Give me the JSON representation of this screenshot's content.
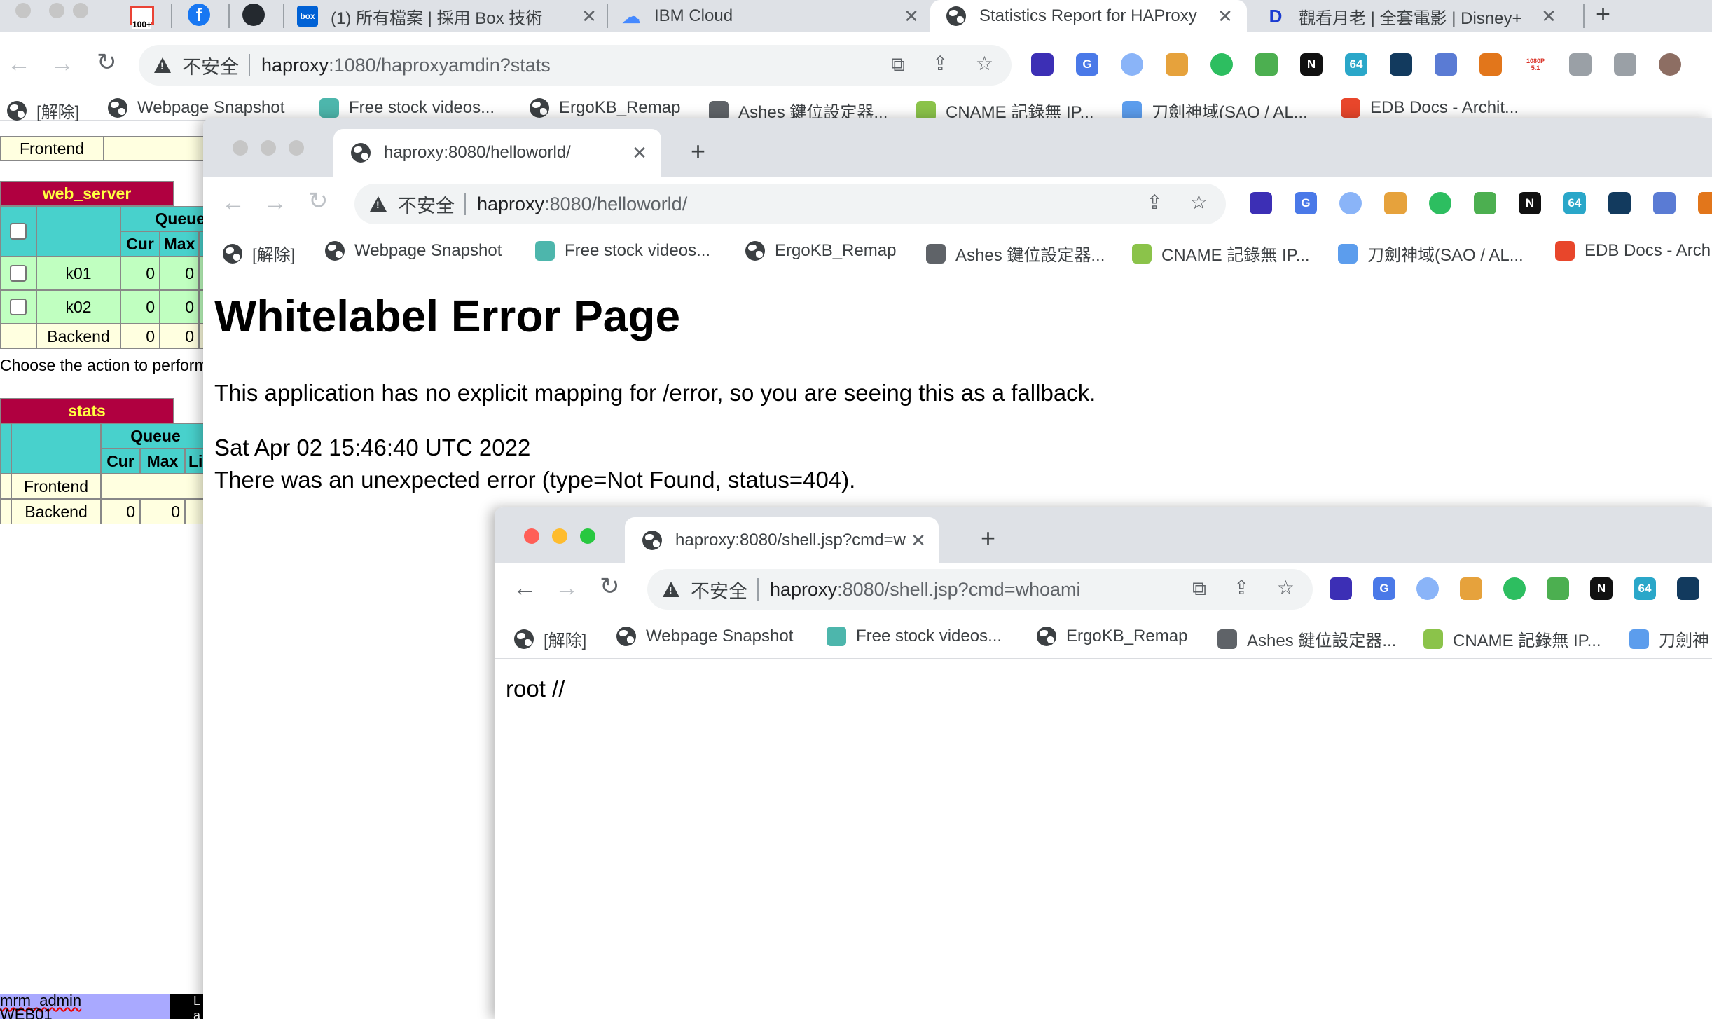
{
  "main_window": {
    "tabs": [
      {
        "favicon": "gmail-icon",
        "badge": "100+"
      },
      {
        "favicon": "facebook-icon"
      },
      {
        "favicon": "github-icon"
      },
      {
        "favicon": "box-icon",
        "title": "(1) 所有檔案 | 採用 Box 技術"
      },
      {
        "favicon": "cloud-icon",
        "title": "IBM Cloud"
      },
      {
        "favicon": "globe-icon",
        "title": "Statistics Report for HAProxy",
        "active": true
      },
      {
        "favicon": "disney-icon",
        "title": "觀看月老 | 全套電影 | Disney+"
      }
    ],
    "omnibox": {
      "insecure": "不安全",
      "host": "haproxy",
      "rest": ":1080/haproxyamdin?stats"
    },
    "extensions": [
      {
        "name": "layers-icon",
        "color": "#3c2fb5",
        "text": ""
      },
      {
        "name": "translate-icon",
        "color": "#4a79e8",
        "text": "G"
      },
      {
        "name": "ring-icon",
        "color": "#8ab4f8",
        "text": ""
      },
      {
        "name": "gallery-icon",
        "color": "#e6a23c",
        "text": ""
      },
      {
        "name": "evernote-icon",
        "color": "#2dbe60",
        "text": ""
      },
      {
        "name": "shield-icon",
        "color": "#4caf50",
        "text": ""
      },
      {
        "name": "notion-icon",
        "color": "#111111",
        "text": "N"
      },
      {
        "name": "base64-icon",
        "color": "#2aa7c9",
        "text": "64"
      },
      {
        "name": "tampermonkey-icon",
        "color": "#123a5e",
        "text": ""
      },
      {
        "name": "ufo-icon",
        "color": "#5a7bd4",
        "text": ""
      },
      {
        "name": "metamask-icon",
        "color": "#e2761b",
        "text": ""
      },
      {
        "name": "resolution-icon",
        "color": "#ffffff",
        "text": "1080P 5.1"
      },
      {
        "name": "puzzle-icon",
        "color": "#9aa0a6",
        "text": ""
      },
      {
        "name": "sidepanel-icon",
        "color": "#9aa0a6",
        "text": ""
      },
      {
        "name": "profile-avatar-icon",
        "color": "#8d6e63",
        "text": ""
      }
    ],
    "bookmarks": [
      {
        "icon": "globe-icon",
        "label": "[解除]"
      },
      {
        "icon": "globe-icon",
        "label": "Webpage Snapshot"
      },
      {
        "icon": "d-icon",
        "label": "Free stock videos..."
      },
      {
        "icon": "globe-icon",
        "label": "ErgoKB_Remap"
      },
      {
        "icon": "keyboard-icon",
        "label": "Ashes 鍵位設定器..."
      },
      {
        "icon": "cname-icon",
        "label": "CNAME 記錄無 IP..."
      },
      {
        "icon": "sao-icon",
        "label": "刀劍神域(SAO / AL..."
      },
      {
        "icon": "edb-icon",
        "label": "EDB Docs - Archit..."
      }
    ]
  },
  "stats": {
    "frontend_top": "Frontend",
    "web_server": {
      "title": "web_server",
      "queue": "Queue",
      "cur": "Cur",
      "max": "Max",
      "rows": [
        {
          "name": "k01",
          "cur": "0",
          "max": "0"
        },
        {
          "name": "k02",
          "cur": "0",
          "max": "0"
        },
        {
          "name": "Backend",
          "cur": "0",
          "max": "0"
        }
      ]
    },
    "action_text": "Choose the action to perform",
    "stats_section": {
      "title": "stats",
      "queue": "Queue",
      "cur": "Cur",
      "max": "Max",
      "li": "Li",
      "frontend": "Frontend",
      "backend": "Backend",
      "backend_cur": "0",
      "backend_max": "0"
    },
    "footer_name": "mrm_admin",
    "footer_name2": "WEB01",
    "footer_dark": "L a"
  },
  "hello_window": {
    "tab_title": "haproxy:8080/helloworld/",
    "omnibox": {
      "insecure": "不安全",
      "host": "haproxy",
      "rest": ":8080/helloworld/"
    },
    "bookmarks": [
      {
        "icon": "globe-icon",
        "label": "[解除]"
      },
      {
        "icon": "globe-icon",
        "label": "Webpage Snapshot"
      },
      {
        "icon": "d-icon",
        "label": "Free stock videos..."
      },
      {
        "icon": "globe-icon",
        "label": "ErgoKB_Remap"
      },
      {
        "icon": "keyboard-icon",
        "label": "Ashes 鍵位設定器..."
      },
      {
        "icon": "cname-icon",
        "label": "CNAME 記錄無 IP..."
      },
      {
        "icon": "sao-icon",
        "label": "刀劍神域(SAO / AL..."
      },
      {
        "icon": "edb-icon",
        "label": "EDB Docs - Arch"
      }
    ],
    "page": {
      "heading": "Whitelabel Error Page",
      "line1": "This application has no explicit mapping for /error, so you are seeing this as a fallback.",
      "timestamp": "Sat Apr 02 15:46:40 UTC 2022",
      "line2": "There was an unexpected error (type=Not Found, status=404)."
    }
  },
  "shell_window": {
    "tab_title": "haproxy:8080/shell.jsp?cmd=w",
    "omnibox": {
      "insecure": "不安全",
      "host": "haproxy",
      "rest": ":8080/shell.jsp?cmd=whoami"
    },
    "bookmarks": [
      {
        "icon": "globe-icon",
        "label": "[解除]"
      },
      {
        "icon": "globe-icon",
        "label": "Webpage Snapshot"
      },
      {
        "icon": "d-icon",
        "label": "Free stock videos..."
      },
      {
        "icon": "globe-icon",
        "label": "ErgoKB_Remap"
      },
      {
        "icon": "keyboard-icon",
        "label": "Ashes 鍵位設定器..."
      },
      {
        "icon": "cname-icon",
        "label": "CNAME 記錄無 IP..."
      },
      {
        "icon": "sao-icon",
        "label": "刀劍神"
      }
    ],
    "page": {
      "output": "root //"
    }
  },
  "colors": {
    "stats_section_header": "#b00040",
    "stats_header_text": "#ffff40",
    "stats_queue_header": "#48d1cc",
    "stats_server_row": "#c0ffc0",
    "traffic_red": "#ff5f57",
    "traffic_yellow": "#febc2e",
    "traffic_green": "#28c840"
  }
}
